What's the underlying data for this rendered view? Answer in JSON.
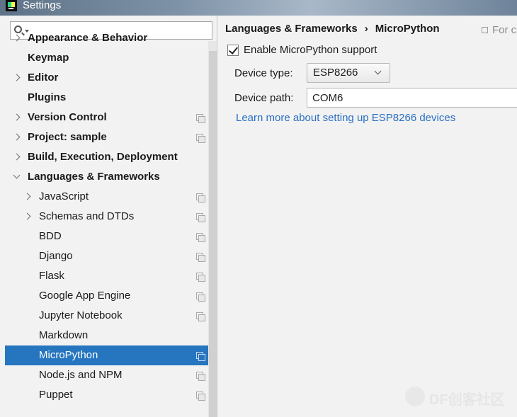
{
  "window": {
    "title": "Settings"
  },
  "search": {
    "placeholder": ""
  },
  "sidebar": {
    "items": [
      {
        "label": "Appearance & Behavior",
        "level": 0,
        "bold": true,
        "arrow": "collapsed",
        "copy": false
      },
      {
        "label": "Keymap",
        "level": 0,
        "bold": true,
        "arrow": "none",
        "copy": false
      },
      {
        "label": "Editor",
        "level": 0,
        "bold": true,
        "arrow": "collapsed",
        "copy": false
      },
      {
        "label": "Plugins",
        "level": 0,
        "bold": true,
        "arrow": "none",
        "copy": false
      },
      {
        "label": "Version Control",
        "level": 0,
        "bold": true,
        "arrow": "collapsed",
        "copy": true
      },
      {
        "label": "Project: sample",
        "level": 0,
        "bold": true,
        "arrow": "collapsed",
        "copy": true
      },
      {
        "label": "Build, Execution, Deployment",
        "level": 0,
        "bold": true,
        "arrow": "collapsed",
        "copy": false
      },
      {
        "label": "Languages & Frameworks",
        "level": 0,
        "bold": true,
        "arrow": "expanded",
        "copy": false
      },
      {
        "label": "JavaScript",
        "level": 1,
        "bold": false,
        "arrow": "collapsed",
        "copy": true
      },
      {
        "label": "Schemas and DTDs",
        "level": 1,
        "bold": false,
        "arrow": "collapsed",
        "copy": true
      },
      {
        "label": "BDD",
        "level": 1,
        "bold": false,
        "arrow": "none",
        "copy": true
      },
      {
        "label": "Django",
        "level": 1,
        "bold": false,
        "arrow": "none",
        "copy": true
      },
      {
        "label": "Flask",
        "level": 1,
        "bold": false,
        "arrow": "none",
        "copy": true
      },
      {
        "label": "Google App Engine",
        "level": 1,
        "bold": false,
        "arrow": "none",
        "copy": true
      },
      {
        "label": "Jupyter Notebook",
        "level": 1,
        "bold": false,
        "arrow": "none",
        "copy": true
      },
      {
        "label": "Markdown",
        "level": 1,
        "bold": false,
        "arrow": "none",
        "copy": false
      },
      {
        "label": "MicroPython",
        "level": 1,
        "bold": false,
        "arrow": "none",
        "copy": true,
        "selected": true
      },
      {
        "label": "Node.js and NPM",
        "level": 1,
        "bold": false,
        "arrow": "none",
        "copy": true
      },
      {
        "label": "Puppet",
        "level": 1,
        "bold": false,
        "arrow": "none",
        "copy": true
      }
    ]
  },
  "content": {
    "breadcrumb": {
      "parent": "Languages & Frameworks",
      "separator": "›",
      "current": "MicroPython"
    },
    "for_current_project": "For c",
    "enable_label": "Enable MicroPython support",
    "enable_checked": true,
    "device_type_label": "Device type:",
    "device_type_value": "ESP8266",
    "device_path_label": "Device path:",
    "device_path_value": "COM6",
    "learn_more_link": "Learn more about setting up ESP8266 devices"
  },
  "watermark": {
    "text": "DF创客社区"
  },
  "colors": {
    "selection": "#2675bf",
    "link": "#2a6fc2",
    "background": "#f2f2f2"
  }
}
